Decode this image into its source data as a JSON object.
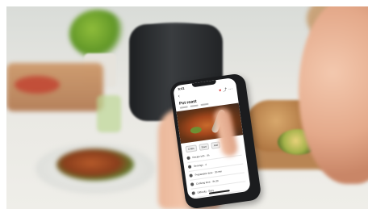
{
  "phone": {
    "status_time": "9:41",
    "recipe_title": "Pot roast",
    "icons": {
      "back": "chevron-left-icon",
      "favorite": "heart-icon",
      "share": "share-icon",
      "more": "more-icon"
    },
    "chips": [
      {
        "label": "Chips"
      },
      {
        "label": "Start"
      },
      {
        "label": "Add"
      }
    ],
    "rows": [
      {
        "label": "Recipe info · 4h"
      },
      {
        "label": "Servings · 4"
      },
      {
        "label": "Preparation time · 30 min"
      },
      {
        "label": "Cooking time · 3h 30"
      },
      {
        "label": "Difficulty · Easy"
      }
    ]
  },
  "colors": {
    "favorite": "#d62b2b",
    "phone_body": "#1b1c1e"
  }
}
